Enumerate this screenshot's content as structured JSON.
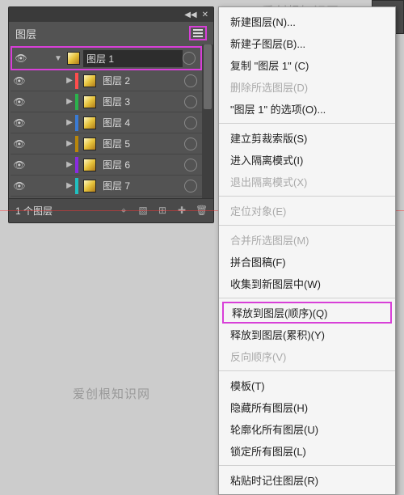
{
  "watermarks": {
    "top": "爱创根知识网",
    "bottom": "爱创根知识网"
  },
  "panel": {
    "title": "图层",
    "footer_count": "1 个图层"
  },
  "layers": [
    {
      "name": "图层 1",
      "expanded": true,
      "selected": true,
      "color": "#d83fd8"
    },
    {
      "name": "图层 2",
      "expanded": false,
      "selected": false,
      "color": "#ff4d4d"
    },
    {
      "name": "图层 3",
      "expanded": false,
      "selected": false,
      "color": "#2bb24c"
    },
    {
      "name": "图层 4",
      "expanded": false,
      "selected": false,
      "color": "#3a7bd5"
    },
    {
      "name": "图层 5",
      "expanded": false,
      "selected": false,
      "color": "#b8860b"
    },
    {
      "name": "图层 6",
      "expanded": false,
      "selected": false,
      "color": "#8a2be2"
    },
    {
      "name": "图层 7",
      "expanded": false,
      "selected": false,
      "color": "#20c0c0"
    }
  ],
  "menu": {
    "items": [
      {
        "label": "新建图层(N)...",
        "enabled": true,
        "sep": false
      },
      {
        "label": "新建子图层(B)...",
        "enabled": true,
        "sep": false
      },
      {
        "label": "复制 \"图层 1\" (C)",
        "enabled": true,
        "sep": false
      },
      {
        "label": "删除所选图层(D)",
        "enabled": false,
        "sep": false
      },
      {
        "label": "\"图层 1\" 的选项(O)...",
        "enabled": true,
        "sep": true
      },
      {
        "label": "建立剪裁索版(S)",
        "enabled": true,
        "sep": false
      },
      {
        "label": "进入隔离模式(I)",
        "enabled": true,
        "sep": false
      },
      {
        "label": "退出隔离模式(X)",
        "enabled": false,
        "sep": true
      },
      {
        "label": "定位对象(E)",
        "enabled": false,
        "sep": true
      },
      {
        "label": "合并所选图层(M)",
        "enabled": false,
        "sep": false
      },
      {
        "label": "拼合图稿(F)",
        "enabled": true,
        "sep": false
      },
      {
        "label": "收集到新图层中(W)",
        "enabled": true,
        "sep": true
      },
      {
        "label": "释放到图层(顺序)(Q)",
        "enabled": true,
        "sep": false,
        "highlight": true
      },
      {
        "label": "释放到图层(累积)(Y)",
        "enabled": true,
        "sep": false
      },
      {
        "label": "反向顺序(V)",
        "enabled": false,
        "sep": true
      },
      {
        "label": "模板(T)",
        "enabled": true,
        "sep": false
      },
      {
        "label": "隐藏所有图层(H)",
        "enabled": true,
        "sep": false
      },
      {
        "label": "轮廓化所有图层(U)",
        "enabled": true,
        "sep": false
      },
      {
        "label": "锁定所有图层(L)",
        "enabled": true,
        "sep": true
      },
      {
        "label": "粘贴时记住图层(R)",
        "enabled": true,
        "sep": false
      }
    ]
  }
}
